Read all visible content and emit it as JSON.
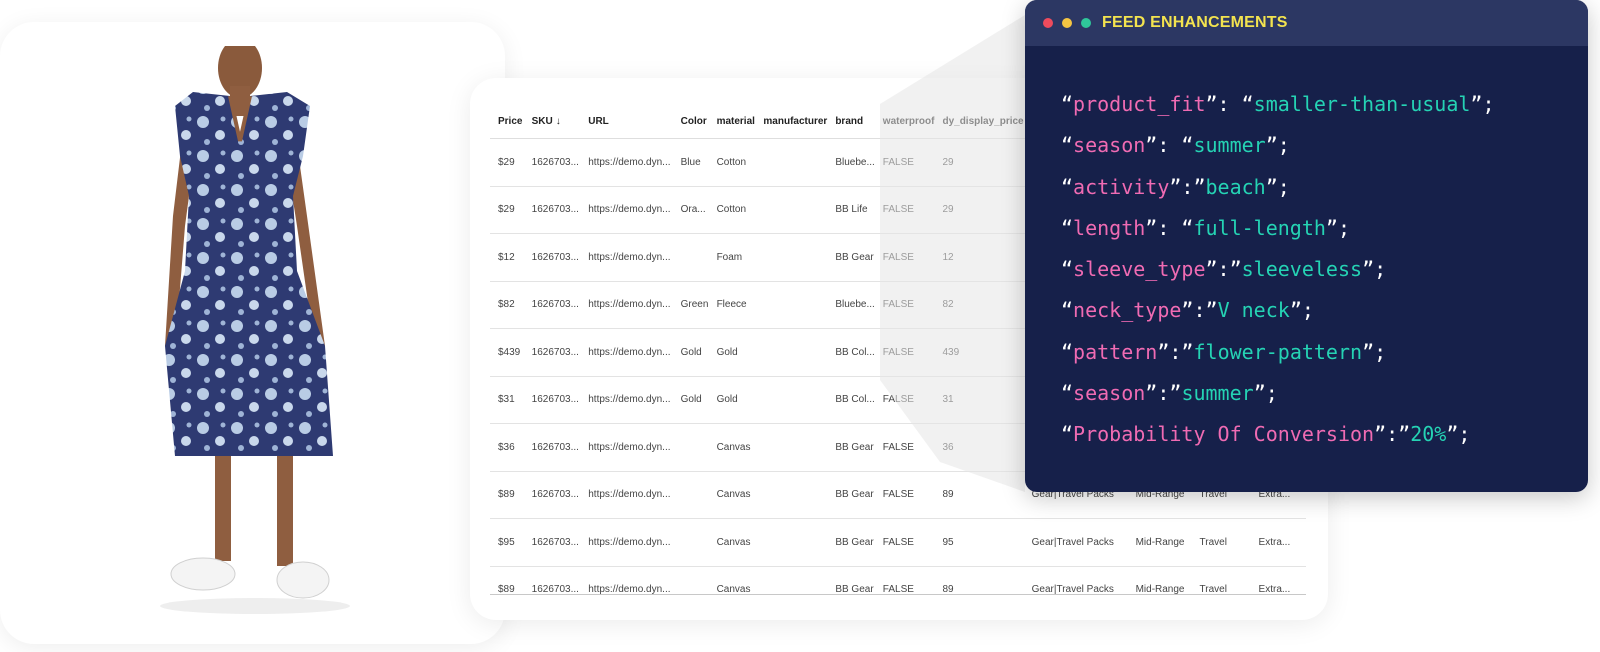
{
  "colors": {
    "window_bg": "#16204a",
    "titlebar_bg": "#2c3763",
    "title_color": "#f3e34f",
    "key_color": "#f06bb3",
    "value_color": "#25d3b4",
    "dot_red": "#ee4b5d",
    "dot_yellow": "#f5c542",
    "dot_green": "#2fc79a",
    "dress_base": "#2e3a72",
    "dress_flower": "#b9cce5"
  },
  "product_image": {
    "icon": "dress-photo"
  },
  "table": {
    "headers": [
      "Price",
      "SKU",
      "URL",
      "Color",
      "material",
      "manufacturer",
      "brand",
      "waterproof",
      "dy_display_price",
      "",
      "",
      "",
      ""
    ],
    "sku_sort_icon": "arrow-down-icon",
    "rows": [
      [
        "$29",
        "1626703...",
        "https://demo.dyn...",
        "Blue",
        "Cotton",
        "",
        "Bluebe...",
        "FALSE",
        "29",
        "",
        "",
        "",
        ""
      ],
      [
        "$29",
        "1626703...",
        "https://demo.dyn...",
        "Ora...",
        "Cotton",
        "",
        "BB Life",
        "FALSE",
        "29",
        "",
        "",
        "",
        ""
      ],
      [
        "$12",
        "1626703...",
        "https://demo.dyn...",
        "",
        "Foam",
        "",
        "BB Gear",
        "FALSE",
        "12",
        "",
        "",
        "",
        ""
      ],
      [
        "$82",
        "1626703...",
        "https://demo.dyn...",
        "Green",
        "Fleece",
        "",
        "Bluebe...",
        "FALSE",
        "82",
        "",
        "",
        "",
        ""
      ],
      [
        "$439",
        "1626703...",
        "https://demo.dyn...",
        "Gold",
        "Gold",
        "",
        "BB Col...",
        "FALSE",
        "439",
        "",
        "",
        "",
        ""
      ],
      [
        "$31",
        "1626703...",
        "https://demo.dyn...",
        "Gold",
        "Gold",
        "",
        "BB Col...",
        "FALSE",
        "31",
        "",
        "",
        "",
        ""
      ],
      [
        "$36",
        "1626703...",
        "https://demo.dyn...",
        "",
        "Canvas",
        "",
        "BB Gear",
        "FALSE",
        "36",
        "",
        "",
        "",
        ""
      ],
      [
        "$89",
        "1626703...",
        "https://demo.dyn...",
        "",
        "Canvas",
        "",
        "BB Gear",
        "FALSE",
        "89",
        "Gear|Travel Packs",
        "Mid-Range",
        "Travel",
        "Extra..."
      ],
      [
        "$95",
        "1626703...",
        "https://demo.dyn...",
        "",
        "Canvas",
        "",
        "BB Gear",
        "FALSE",
        "95",
        "Gear|Travel Packs",
        "Mid-Range",
        "Travel",
        "Extra..."
      ],
      [
        "$89",
        "1626703...",
        "https://demo.dyn...",
        "",
        "Canvas",
        "",
        "BB Gear",
        "FALSE",
        "89",
        "Gear|Travel Packs",
        "Mid-Range",
        "Travel",
        "Extra..."
      ]
    ]
  },
  "code_window": {
    "title": "FEED ENHANCEMENTS",
    "lines": [
      {
        "key": "product_fit",
        "sep": ": “",
        "value": "smaller-than-usual"
      },
      {
        "key": "season",
        "sep": ": “",
        "value": "summer"
      },
      {
        "key": "activity",
        "sep": ":”",
        "value": "beach"
      },
      {
        "key": "length",
        "sep": ": “",
        "value": "full-length"
      },
      {
        "key": "sleeve_type",
        "sep": ":”",
        "value": "sleeveless"
      },
      {
        "key": "neck_type",
        "sep": ":”",
        "value": "V neck"
      },
      {
        "key": "pattern",
        "sep": ":”",
        "value": "flower-pattern"
      },
      {
        "key": "season",
        "sep": ":”",
        "value": "summer"
      },
      {
        "key": "Probability Of Conversion",
        "sep": ":”",
        "value": "20%"
      }
    ]
  }
}
